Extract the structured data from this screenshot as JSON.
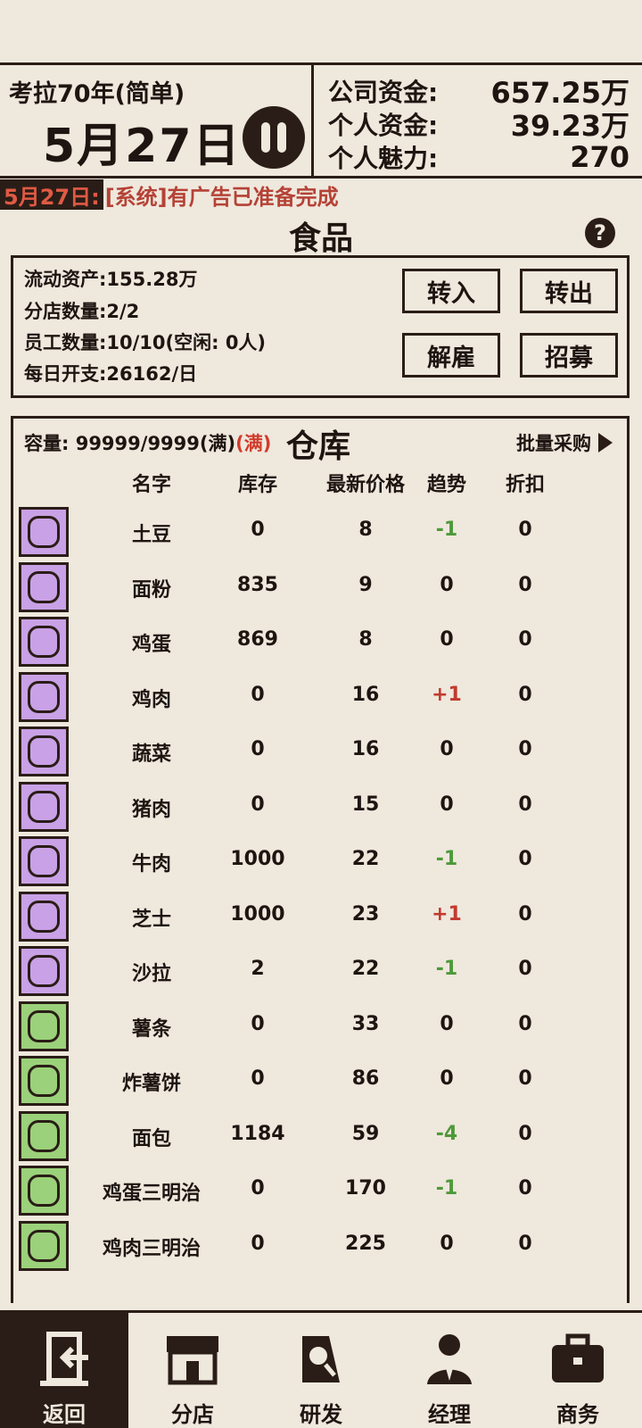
{
  "header": {
    "save_title": "考拉70年(简单)",
    "date": "5月27日",
    "stats": [
      {
        "label": "公司资金:",
        "value": "657.25万"
      },
      {
        "label": "个人资金:",
        "value": "39.23万"
      },
      {
        "label": "个人魅力:",
        "value": "270"
      }
    ]
  },
  "ticker": {
    "date": "5月27日:",
    "message": "[系统]有广告已准备完成"
  },
  "section": {
    "title": "食品",
    "help": "?"
  },
  "info": {
    "liquid_assets": "流动资产:155.28万",
    "branches": "分店数量:2/2",
    "staff": "员工数量:10/10(空闲: 0人)",
    "daily_cost": "每日开支:26162/日",
    "buttons": {
      "transfer_in": "转入",
      "transfer_out": "转出",
      "fire": "解雇",
      "recruit": "招募"
    }
  },
  "warehouse": {
    "capacity_label": "容量: 99999/9999(满)",
    "capacity_full": "(满)",
    "title": "仓库",
    "bulk_buy": "批量采购",
    "columns": {
      "name": "名字",
      "stock": "库存",
      "price": "最新价格",
      "trend": "趋势",
      "discount": "折扣"
    },
    "items": [
      {
        "name": "土豆",
        "stock": "0",
        "price": "8",
        "trend": "-1",
        "discount": "0",
        "icon": "potato-icon",
        "bg": "purple"
      },
      {
        "name": "面粉",
        "stock": "835",
        "price": "9",
        "trend": "0",
        "discount": "0",
        "icon": "flour-icon",
        "bg": "purple"
      },
      {
        "name": "鸡蛋",
        "stock": "869",
        "price": "8",
        "trend": "0",
        "discount": "0",
        "icon": "egg-icon",
        "bg": "purple"
      },
      {
        "name": "鸡肉",
        "stock": "0",
        "price": "16",
        "trend": "+1",
        "discount": "0",
        "icon": "chicken-icon",
        "bg": "purple"
      },
      {
        "name": "蔬菜",
        "stock": "0",
        "price": "16",
        "trend": "0",
        "discount": "0",
        "icon": "broccoli-icon",
        "bg": "purple"
      },
      {
        "name": "猪肉",
        "stock": "0",
        "price": "15",
        "trend": "0",
        "discount": "0",
        "icon": "pork-icon",
        "bg": "purple"
      },
      {
        "name": "牛肉",
        "stock": "1000",
        "price": "22",
        "trend": "-1",
        "discount": "0",
        "icon": "beef-icon",
        "bg": "purple"
      },
      {
        "name": "芝士",
        "stock": "1000",
        "price": "23",
        "trend": "+1",
        "discount": "0",
        "icon": "cheese-icon",
        "bg": "purple"
      },
      {
        "name": "沙拉",
        "stock": "2",
        "price": "22",
        "trend": "-1",
        "discount": "0",
        "icon": "salad-icon",
        "bg": "purple"
      },
      {
        "name": "薯条",
        "stock": "0",
        "price": "33",
        "trend": "0",
        "discount": "0",
        "icon": "fries-icon",
        "bg": "green"
      },
      {
        "name": "炸薯饼",
        "stock": "0",
        "price": "86",
        "trend": "0",
        "discount": "0",
        "icon": "hashbrown-icon",
        "bg": "green"
      },
      {
        "name": "面包",
        "stock": "1184",
        "price": "59",
        "trend": "-4",
        "discount": "0",
        "icon": "bread-icon",
        "bg": "green"
      },
      {
        "name": "鸡蛋三明治",
        "stock": "0",
        "price": "170",
        "trend": "-1",
        "discount": "0",
        "icon": "egg-sandwich-icon",
        "bg": "green"
      },
      {
        "name": "鸡肉三明治",
        "stock": "0",
        "price": "225",
        "trend": "0",
        "discount": "0",
        "icon": "chicken-sandwich-icon",
        "bg": "green"
      }
    ]
  },
  "nav": [
    {
      "label": "返回",
      "icon": "back-door-icon",
      "active": true
    },
    {
      "label": "分店",
      "icon": "shop-icon",
      "active": false
    },
    {
      "label": "研发",
      "icon": "research-icon",
      "active": false
    },
    {
      "label": "经理",
      "icon": "manager-icon",
      "active": false
    },
    {
      "label": "商务",
      "icon": "briefcase-icon",
      "active": false
    }
  ],
  "colors": {
    "background": "#efe8dd",
    "ink": "#2a1d17",
    "trend_up": "#c23a2f",
    "trend_down": "#4d9a3a",
    "icon_purple": "#c9a1e6",
    "icon_green": "#9bd17a"
  }
}
